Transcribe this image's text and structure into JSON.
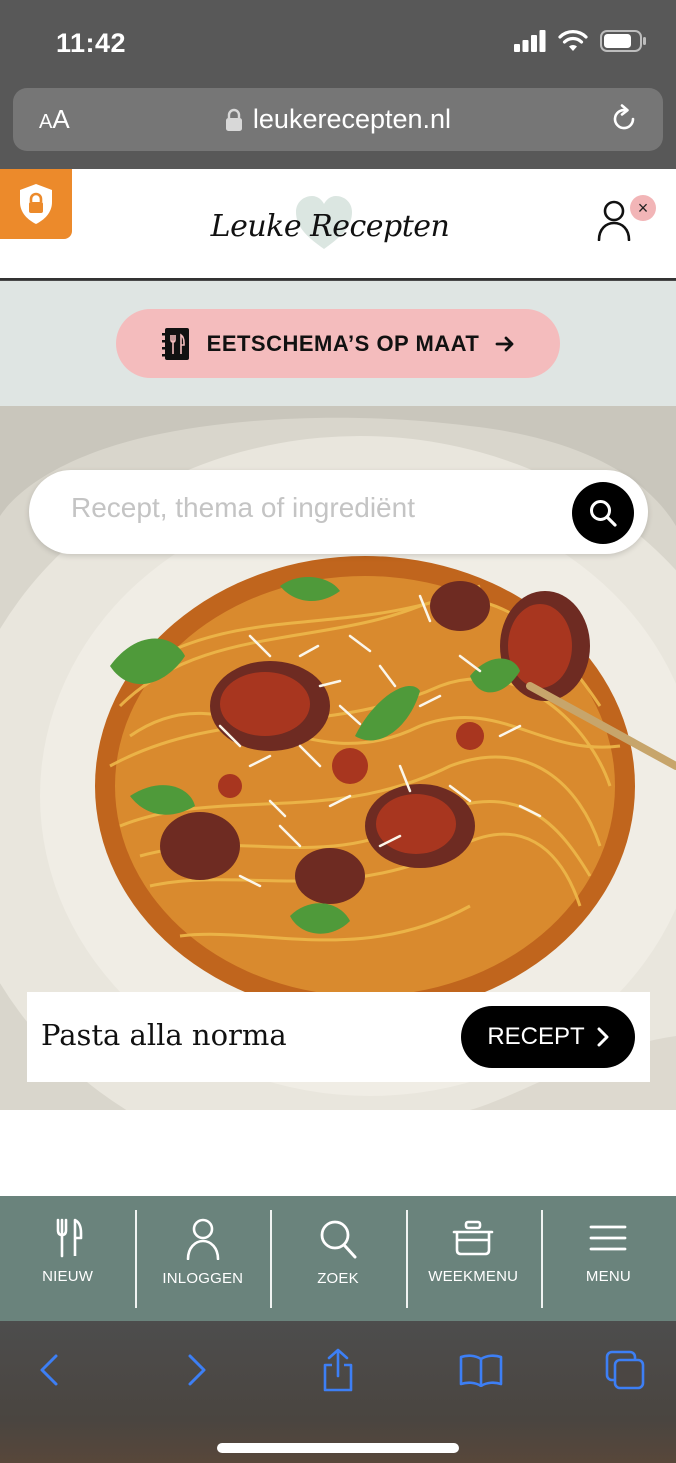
{
  "status_bar": {
    "time": "11:42"
  },
  "browser": {
    "aa_label_small": "A",
    "aa_label_large": "A",
    "url": "leukerecepten.nl"
  },
  "site": {
    "logo_text": "Leuke Recepten",
    "account_close": "×"
  },
  "promo": {
    "label": "EETSCHEMA’S OP MAAT"
  },
  "search": {
    "placeholder": "Recept, thema of ingrediënt"
  },
  "featured": {
    "title": "Pasta alla norma",
    "button_label": "RECEPT"
  },
  "nav": {
    "items": [
      {
        "label": "NIEUW",
        "icon": "fork-knife-icon"
      },
      {
        "label": "INLOGGEN",
        "icon": "user-icon"
      },
      {
        "label": "ZOEK",
        "icon": "search-icon"
      },
      {
        "label": "WEEKMENU",
        "icon": "pot-icon"
      },
      {
        "label": "MENU",
        "icon": "hamburger-icon"
      }
    ]
  },
  "colors": {
    "privacy_badge": "#ec8a2b",
    "promo_pink": "#f4bcbd",
    "nav_green": "#6a837c",
    "safari_blue": "#3d7ff5"
  }
}
